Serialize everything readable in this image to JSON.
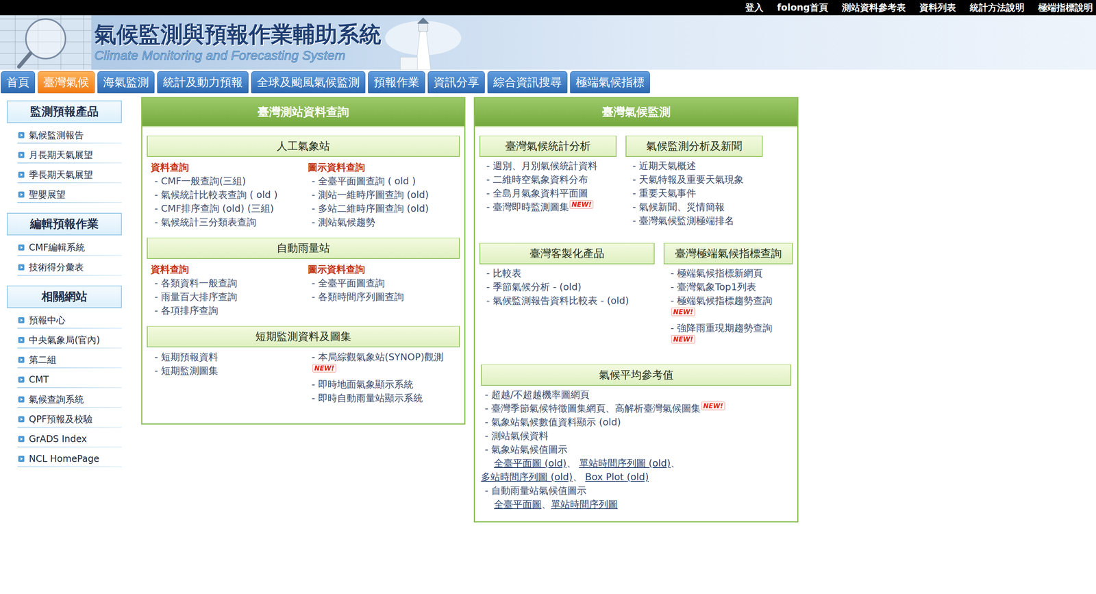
{
  "topbar": {
    "links": [
      "登入",
      "folong首頁",
      "測站資料參考表",
      "資料列表",
      "統計方法說明",
      "極端指標說明"
    ]
  },
  "header": {
    "title": "氣候監測與預報作業輔助系統",
    "subtitle": "Climate Monitoring and Forecasting System"
  },
  "tabs": [
    {
      "label": "首頁",
      "selected": false
    },
    {
      "label": "臺灣氣候",
      "selected": true
    },
    {
      "label": "海氣監測",
      "selected": false
    },
    {
      "label": "統計及動力預報",
      "selected": false
    },
    {
      "label": "全球及颱風氣候監測",
      "selected": false
    },
    {
      "label": "預報作業",
      "selected": false
    },
    {
      "label": "資訊分享",
      "selected": false
    },
    {
      "label": "綜合資訊搜尋",
      "selected": false
    },
    {
      "label": "極端氣候指標",
      "selected": false
    }
  ],
  "sidebar": {
    "sections": [
      {
        "title": "監測預報產品",
        "items": [
          "氣候監測報告",
          "月長期天氣展望",
          "季長期天氣展望",
          "聖嬰展望"
        ]
      },
      {
        "title": "編輯預報作業",
        "items": [
          "CMF編輯系統",
          "技術得分彙表"
        ]
      },
      {
        "title": "相關網站",
        "items": [
          "預報中心",
          "中央氣象局(官內)",
          "第二組",
          "CMT",
          "氣候查詢系統",
          "QPF預報及校驗",
          "GrADS Index",
          "NCL HomePage"
        ]
      }
    ]
  },
  "left_panel": {
    "title": "臺灣測站資料查詢",
    "groups": [
      {
        "title": "人工氣象站",
        "columns": [
          {
            "heading": "資料查詢",
            "items": [
              {
                "label": "- CMF一般查詢(三組)",
                "new": false
              },
              {
                "label": "- 氣候統計比較表查詢 ( old )",
                "new": false
              },
              {
                "label": "- CMF排序查詢 (old) (三組)",
                "new": false
              },
              {
                "label": "- 氣候統計三分類表查詢",
                "new": false
              }
            ]
          },
          {
            "heading": "圖示資料查詢",
            "items": [
              {
                "label": "- 全臺平面圖查詢 ( old )",
                "new": false
              },
              {
                "label": "- 測站一維時序圖查詢 (old)",
                "new": false
              },
              {
                "label": "- 多站二維時序圖查詢 (old)",
                "new": false
              },
              {
                "label": "- 測站氣候趨勢",
                "new": false
              }
            ]
          }
        ]
      },
      {
        "title": "自動雨量站",
        "columns": [
          {
            "heading": "資料查詢",
            "items": [
              {
                "label": "- 各類資料一般查詢",
                "new": false
              },
              {
                "label": "- 雨量百大排序查詢",
                "new": false
              },
              {
                "label": "- 各項排序查詢",
                "new": false
              }
            ]
          },
          {
            "heading": "圖示資料查詢",
            "items": [
              {
                "label": "- 全臺平面圖查詢",
                "new": false
              },
              {
                "label": "- 各類時間序列圖查詢",
                "new": false
              }
            ]
          }
        ]
      },
      {
        "title": "短期監測資料及圖集",
        "columns": [
          {
            "heading": "",
            "items": [
              {
                "label": "- 短期預報資料",
                "new": false
              },
              {
                "label": "- 短期監測圖集",
                "new": false
              }
            ]
          },
          {
            "heading": "",
            "items": [
              {
                "label": "- 本局綜觀氣象站(SYNOP)觀測",
                "new": true
              },
              {
                "label": "- 即時地面氣象顯示系統",
                "new": false
              },
              {
                "label": "- 即時自動雨量站顯示系統",
                "new": false
              }
            ]
          }
        ]
      }
    ]
  },
  "right_panel": {
    "title": "臺灣氣候監測",
    "row1": [
      {
        "title": "臺灣氣候統計分析",
        "items": [
          {
            "label": "- 週別、月別氣候統計資料",
            "new": false
          },
          {
            "label": "- 二維時空氣象資料分布",
            "new": false
          },
          {
            "label": "- 全島月氣象資料平面圖",
            "new": false
          },
          {
            "label": "- 臺灣即時監測圖集",
            "new": true
          }
        ]
      },
      {
        "title": "氣候監測分析及新聞",
        "items": [
          {
            "label": "- 近期天氣概述",
            "new": false
          },
          {
            "label": "- 天氣特報及重要天氣現象",
            "new": false
          },
          {
            "label": "- 重要天氣事件",
            "new": false
          },
          {
            "label": "- 氣候新聞、災情簡報",
            "new": false
          },
          {
            "label": "- 臺灣氣候監測極端排名",
            "new": false
          }
        ]
      }
    ],
    "row2": [
      {
        "title": "臺灣客製化產品",
        "items": [
          {
            "label": "- 比較表",
            "new": false
          },
          {
            "label": "- 季節氣候分析 - (old)",
            "new": false
          },
          {
            "label": "- 氣候監測報告資料比較表 - (old)",
            "new": false
          }
        ]
      },
      {
        "title": "臺灣極端氣候指標查詢",
        "items": [
          {
            "label": "- 極端氣候指標新網頁",
            "new": false
          },
          {
            "label": "- 臺灣氣象Top1列表",
            "new": false
          },
          {
            "label": "- 極端氣候指標趨勢查詢",
            "new": true
          },
          {
            "label": "- 強降雨重現期趨勢查詢",
            "new": true
          }
        ]
      }
    ],
    "climate": {
      "title": "氣候平均參考值",
      "items": [
        {
          "label": "- 超越/不超越機率圖網頁",
          "new": false,
          "lines": []
        },
        {
          "label": "- 臺灣季節氣候特徵圖集網頁、高解析臺灣氣候圖集",
          "new": true,
          "lines": []
        },
        {
          "label": "- 氣象站氣候數值資料顯示 (old)",
          "new": false,
          "lines": []
        },
        {
          "label": "- 測站氣候資料",
          "new": false,
          "lines": []
        },
        {
          "label": "- 氣象站氣候值圖示",
          "new": false,
          "lines": [
            [
              {
                "text": "全臺平面圖 (old)",
                "link": true
              },
              {
                "text": "、 ",
                "link": false
              },
              {
                "text": "單站時間序列圖 (old)",
                "link": true
              },
              {
                "text": "、",
                "link": false
              }
            ],
            [
              {
                "text": "多站時間序列圖 (old)",
                "link": true
              },
              {
                "text": "、 ",
                "link": false
              },
              {
                "text": "Box Plot (old)",
                "link": true
              }
            ]
          ]
        },
        {
          "label": "- 自動雨量站氣候值圖示",
          "new": false,
          "lines": [
            [
              {
                "text": "全臺平面圖",
                "link": true
              },
              {
                "text": "、",
                "link": false
              },
              {
                "text": "單站時間序列圖",
                "link": true
              }
            ]
          ]
        }
      ]
    }
  },
  "badge": "NEW!"
}
